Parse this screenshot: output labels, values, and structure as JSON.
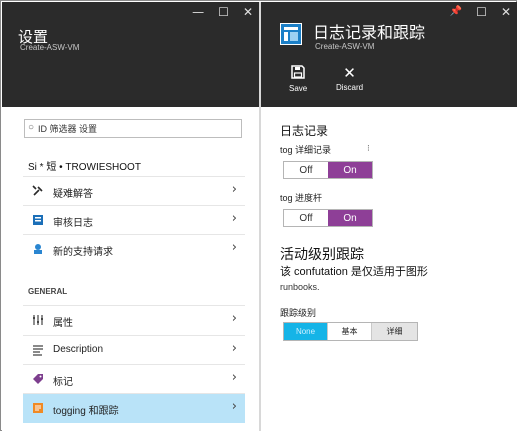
{
  "settings_blade": {
    "title": "设置",
    "subtitle": "Create-ASW-VM",
    "filter": {
      "value": "ID 筛选器 设置",
      "placeholder": ""
    },
    "support_section_label": "Si * 短 • TROWIESHOOT",
    "support_items": [
      {
        "label": "疑难解答",
        "icon": "wrench-icon"
      },
      {
        "label": "审核日志",
        "icon": "audit-log-icon"
      },
      {
        "label": "新的支持请求",
        "icon": "support-request-icon"
      }
    ],
    "general_section_label": "GENERAL",
    "general_items": [
      {
        "label": "属性",
        "icon": "properties-icon"
      },
      {
        "label": "Description",
        "icon": "description-icon"
      },
      {
        "label": "标记",
        "icon": "tag-icon"
      },
      {
        "label": "togging 和跟踪",
        "icon": "logging-icon"
      }
    ],
    "window_controls": [
      "—",
      "☐",
      "✕"
    ]
  },
  "logging_blade": {
    "title": "日志记录和跟踪",
    "subtitle": "Create-ASW-VM",
    "window_controls": [
      "📌",
      "☐",
      "✕"
    ],
    "commands": [
      {
        "label": "Save",
        "icon": "save-icon"
      },
      {
        "label": "Discard",
        "icon": "discard-icon"
      }
    ],
    "logging": {
      "heading": "日志记录",
      "verbose_label": "tog 详细记录",
      "verbose_info": "⁝",
      "verbose_off": "Off",
      "verbose_on": "On",
      "progress_label": "tog 进度杆",
      "progress_off": "Off",
      "progress_on": "On"
    },
    "tracing": {
      "heading": "活动级别跟踪",
      "description": "该 confutation 是仅适用于图形",
      "description2": "runbooks.",
      "level_label": "跟踪级别",
      "levels": [
        "None",
        "基本",
        "详细"
      ],
      "selected_level": "None"
    }
  },
  "colors": {
    "header": "#2b2b2b",
    "accent_purple": "#8e3f97",
    "accent_blue": "#15b4e7",
    "selected_row": "#b9e3f8"
  }
}
